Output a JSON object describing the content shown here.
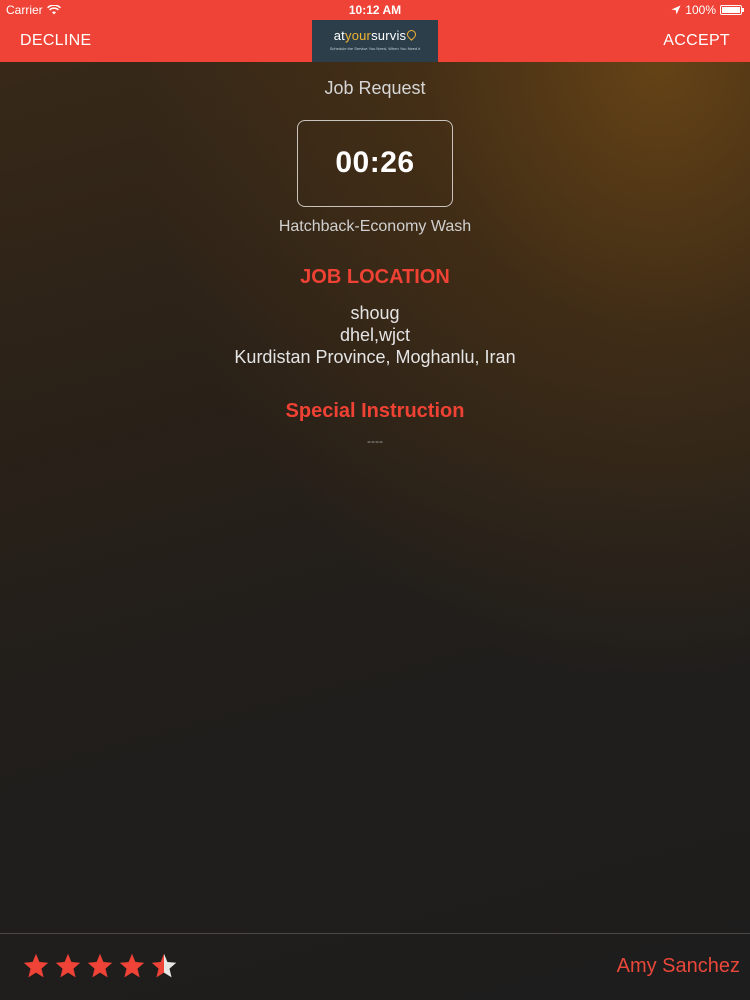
{
  "status_bar": {
    "carrier": "Carrier",
    "time": "10:12 AM",
    "battery": "100%"
  },
  "nav": {
    "decline_label": "DECLINE",
    "accept_label": "ACCEPT",
    "logo": {
      "brand_prefix": "at",
      "brand_accent": "your",
      "brand_suffix": "survis",
      "tagline": "Schedule the Service You Need, When You Need it"
    }
  },
  "job": {
    "title": "Job Request",
    "timer": "00:26",
    "service": "Hatchback-Economy Wash",
    "location_heading": "JOB LOCATION",
    "address_lines": [
      "shoug",
      "dhel,wjct",
      "Kurdistan Province,  Moghanlu,  Iran"
    ],
    "instruction_heading": "Special Instruction",
    "instruction_text": "----"
  },
  "footer": {
    "rating": 4.5,
    "rating_max": 5,
    "customer_name": "Amy Sanchez"
  },
  "colors": {
    "accent_red": "#ee4336",
    "logo_bg": "#2b3e4a",
    "logo_accent": "#f2b233",
    "star_filled": "#ee4336",
    "star_empty": "#e6e6e6"
  },
  "icons": {
    "wifi": "wifi-icon",
    "location_arrow": "location-arrow-icon",
    "battery": "battery-icon",
    "star": "star-icon",
    "logo_pin": "map-pin-icon"
  }
}
